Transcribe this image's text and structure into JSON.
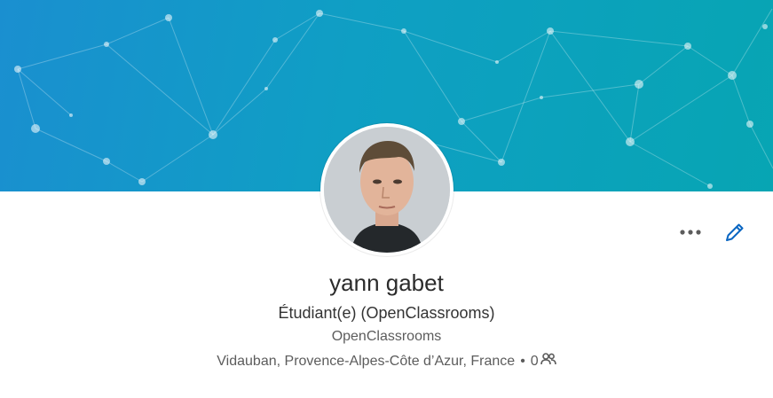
{
  "profile": {
    "name": "yann gabet",
    "headline": "Étudiant(e) (OpenClassrooms)",
    "company": "OpenClassrooms",
    "location": "Vidauban, Provence-Alpes-Côte d’Azur, France",
    "separator": "•",
    "connections": "0"
  },
  "icons": {
    "more": "more-horizontal-icon",
    "edit": "pencil-icon",
    "connections": "people-icon"
  },
  "colors": {
    "banner_start": "#1a8fd0",
    "banner_end": "#07a5b3",
    "accent": "#0a66c2",
    "text_primary": "#2b2b2b",
    "text_secondary": "#5c5c5c"
  }
}
